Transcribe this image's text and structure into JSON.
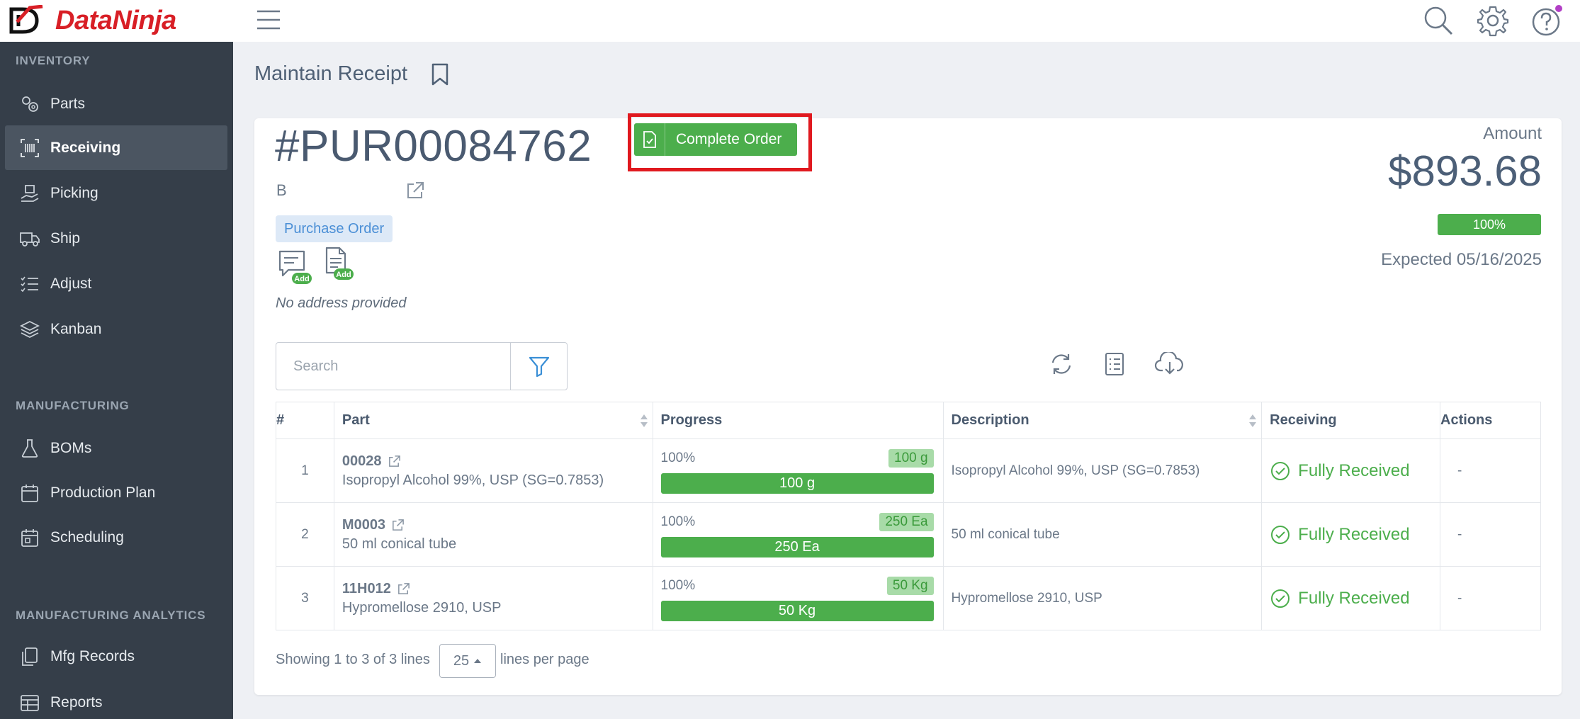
{
  "brand": {
    "name_part1": "Data",
    "name_part2": "Ninja"
  },
  "sidebar": {
    "sections": [
      {
        "title": "INVENTORY"
      },
      {
        "title": "MANUFACTURING"
      },
      {
        "title": "MANUFACTURING ANALYTICS"
      }
    ],
    "items": [
      {
        "label": "Parts",
        "icon": "gears-icon"
      },
      {
        "label": "Receiving",
        "icon": "barcode-icon",
        "active": true
      },
      {
        "label": "Picking",
        "icon": "hand-box-icon"
      },
      {
        "label": "Ship",
        "icon": "truck-icon"
      },
      {
        "label": "Adjust",
        "icon": "checklist-icon"
      },
      {
        "label": "Kanban",
        "icon": "layers-icon"
      },
      {
        "label": "BOMs",
        "icon": "flask-icon"
      },
      {
        "label": "Production Plan",
        "icon": "calendar-icon"
      },
      {
        "label": "Scheduling",
        "icon": "calendar-check-icon"
      },
      {
        "label": "Mfg Records",
        "icon": "documents-icon"
      },
      {
        "label": "Reports",
        "icon": "table-icon"
      }
    ]
  },
  "page": {
    "title": "Maintain Receipt"
  },
  "order": {
    "number": "#PUR00084762",
    "vendor": "B",
    "type_badge": "Purchase Order",
    "add_label": "Add",
    "no_address": "No address provided",
    "complete_button": "Complete Order",
    "amount_label": "Amount",
    "amount_value": "$893.68",
    "amount_pct": "100%",
    "expected": "Expected 05/16/2025"
  },
  "search": {
    "placeholder": "Search"
  },
  "table": {
    "headers": {
      "num": "#",
      "part": "Part",
      "progress": "Progress",
      "description": "Description",
      "receiving": "Receiving",
      "actions": "Actions"
    },
    "rows": [
      {
        "num": "1",
        "code": "00028",
        "name": "Isopropyl Alcohol 99%, USP (SG=0.7853)",
        "pct": "100%",
        "tag": "100 g",
        "bar": "100 g",
        "progress": 1.0,
        "description": "Isopropyl Alcohol 99%, USP (SG=0.7853)",
        "status": "Fully Received",
        "action": "-"
      },
      {
        "num": "2",
        "code": "M0003",
        "name": "50 ml conical tube",
        "pct": "100%",
        "tag": "250 Ea",
        "bar": "250 Ea",
        "progress": 1.0,
        "description": "50 ml conical tube",
        "status": "Fully Received",
        "action": "-"
      },
      {
        "num": "3",
        "code": "11H012",
        "name": "Hypromellose 2910, USP",
        "pct": "100%",
        "tag": "50 Kg",
        "bar": "50 Kg",
        "progress": 1.0,
        "description": "Hypromellose 2910, USP",
        "status": "Fully Received",
        "action": "-"
      }
    ]
  },
  "footer": {
    "showing": "Showing 1 to 3 of 3 lines",
    "per_page_value": "25",
    "per_page_label": "lines per page"
  },
  "colors": {
    "accent_green": "#4cae4c",
    "brand_red": "#d81f26",
    "sidebar_bg": "#353e49",
    "highlight_red": "#e0191f"
  }
}
